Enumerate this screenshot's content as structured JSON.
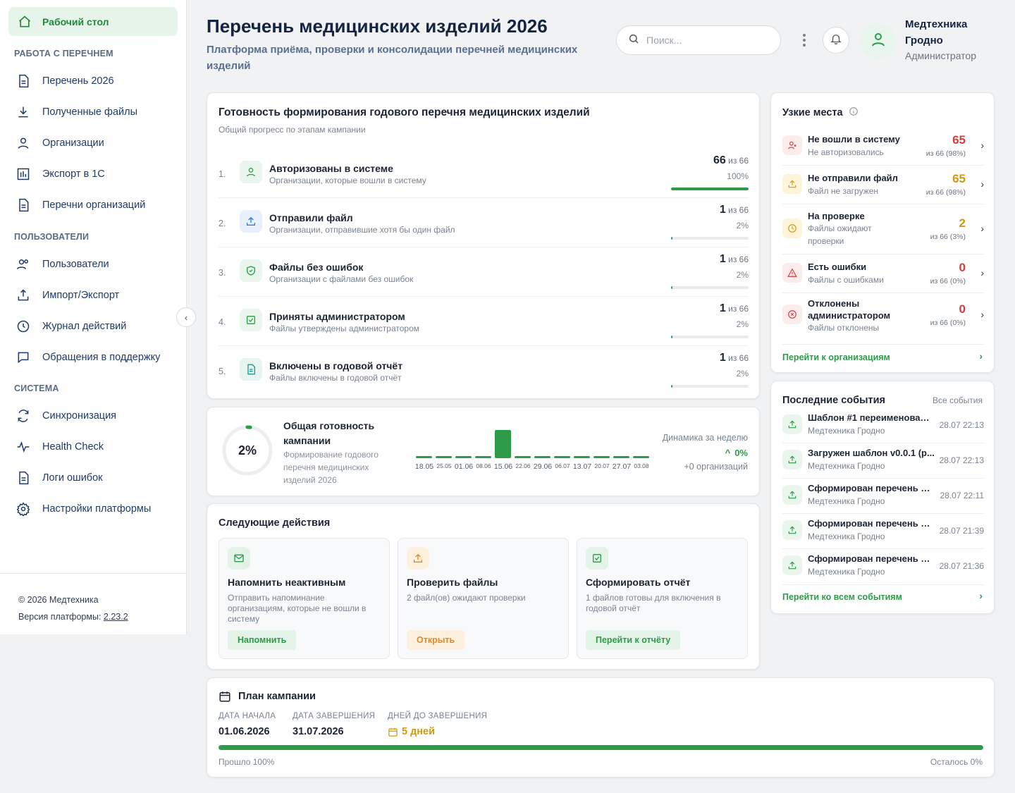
{
  "sidebar": {
    "active": "Рабочий стол",
    "sections": [
      {
        "title": "РАБОТА С ПЕРЕЧНЕМ",
        "items": [
          "Перечень 2026",
          "Полученные файлы",
          "Организации",
          "Экспорт в 1С",
          "Перечни организаций"
        ]
      },
      {
        "title": "ПОЛЬЗОВАТЕЛИ",
        "items": [
          "Пользователи",
          "Импорт/Экспорт",
          "Журнал действий",
          "Обращения в поддержку"
        ]
      },
      {
        "title": "СИСТЕМА",
        "items": [
          "Синхронизация",
          "Health Check",
          "Логи ошибок",
          "Настройки платформы"
        ]
      }
    ],
    "footer": {
      "copyright": "© 2026 Медтехника",
      "version_label": "Версия платформы:",
      "version": "2.23.2"
    }
  },
  "header": {
    "title": "Перечень медицинских изделий 2026",
    "subtitle": "Платформа приёма, проверки и консолидации перечней медицинских изделий",
    "search_placeholder": "Поиск...",
    "user_name": "Медтехника Гродно",
    "user_role": "Администратор"
  },
  "readiness": {
    "title": "Готовность формирования годового перечня медицинских изделий",
    "subtitle": "Общий прогресс по этапам кампании",
    "of_label": "из 66",
    "stages": [
      {
        "num": "1.",
        "name": "Авторизованы в системе",
        "desc": "Организации, которые вошли в систему",
        "count": "66",
        "pct": "100%",
        "fill": 1.0
      },
      {
        "num": "2.",
        "name": "Отправили файл",
        "desc": "Организации, отправившие хотя бы один файл",
        "count": "1",
        "pct": "2%",
        "fill": 0.02
      },
      {
        "num": "3.",
        "name": "Файлы без ошибок",
        "desc": "Организации с файлами без ошибок",
        "count": "1",
        "pct": "2%",
        "fill": 0.02
      },
      {
        "num": "4.",
        "name": "Приняты администратором",
        "desc": "Файлы утверждены администратором",
        "count": "1",
        "pct": "2%",
        "fill": 0.02
      },
      {
        "num": "5.",
        "name": "Включены в годовой отчёт",
        "desc": "Файлы включены в годовой отчёт",
        "count": "1",
        "pct": "2%",
        "fill": 0.02
      }
    ]
  },
  "bottlenecks": {
    "title": "Узкие места",
    "items": [
      {
        "name": "Не вошли в систему",
        "desc": "Не авторизовались",
        "value": "65",
        "of": "из 66 (98%)"
      },
      {
        "name": "Не отправили файл",
        "desc": "Файл не загружен",
        "value": "65",
        "of": "из 66 (98%)"
      },
      {
        "name": "На проверке",
        "desc": "Файлы ожидают проверки",
        "value": "2",
        "of": "из 66 (3%)"
      },
      {
        "name": "Есть ошибки",
        "desc": "Файлы с ошибками",
        "value": "0",
        "of": "из 66 (0%)"
      },
      {
        "name": "Отклонены администратором",
        "desc": "Файлы отклонены",
        "value": "0",
        "of": "из 66 (0%)"
      }
    ],
    "link": "Перейти к организациям"
  },
  "overall": {
    "value": "2%",
    "fill": 0.02,
    "title": "Общая готовность кампании",
    "desc": "Формирование годового перечня медицинских изделий 2026",
    "dynamics_label": "Динамика за неделю",
    "dynamics_value": "0%",
    "dynamics_orgs": "+0 организаций"
  },
  "chart_data": {
    "type": "bar",
    "categories": [
      "18.05",
      "25.05",
      "01.06",
      "08.06",
      "15.06",
      "22.06",
      "29.06",
      "06.07",
      "13.07",
      "20.07",
      "27.07",
      "03.08"
    ],
    "values": [
      0,
      0,
      0,
      0,
      1,
      0,
      0,
      0,
      0,
      0,
      0,
      0
    ]
  },
  "events": {
    "title": "Последние события",
    "all_link": "Все события",
    "items": [
      {
        "name": "Шаблон #1 переименован: ...",
        "org": "Медтехника Гродно",
        "time": "28.07 22:13"
      },
      {
        "name": "Загружен шаблон v0.0.1 (р...",
        "org": "Медтехника Гродно",
        "time": "28.07 22:13"
      },
      {
        "name": "Сформирован перечень дл...",
        "org": "Медтехника Гродно",
        "time": "28.07 22:11"
      },
      {
        "name": "Сформирован перечень дл...",
        "org": "Медтехника Гродно",
        "time": "28.07 21:39"
      },
      {
        "name": "Сформирован перечень дл...",
        "org": "Медтехника Гродно",
        "time": "28.07 21:36"
      }
    ],
    "link": "Перейти ко всем событиям"
  },
  "next_actions": {
    "title": "Следующие действия",
    "items": [
      {
        "name": "Напомнить неактивным",
        "desc": "Отправить напоминание организациям, которые не вошли в систему",
        "button": "Напомнить"
      },
      {
        "name": "Проверить файлы",
        "desc": "2 файл(ов) ожидают проверки",
        "button": "Открыть"
      },
      {
        "name": "Сформировать отчёт",
        "desc": "1 файлов готовы для включения в годовой отчёт",
        "button": "Перейти к отчёту"
      }
    ]
  },
  "plan": {
    "title": "План кампании",
    "start_label": "ДАТА НАЧАЛА",
    "start": "01.06.2026",
    "end_label": "ДАТА ЗАВЕРШЕНИЯ",
    "end": "31.07.2026",
    "days_label": "ДНЕЙ ДО ЗАВЕРШЕНИЯ",
    "days": "5 дней",
    "passed": "Прошло 100%",
    "left": "Осталось 0%",
    "progress": 1.0
  },
  "colors": {
    "accent": "#2d9b47",
    "danger": "#d93a3a",
    "warning": "#d49a0b"
  }
}
